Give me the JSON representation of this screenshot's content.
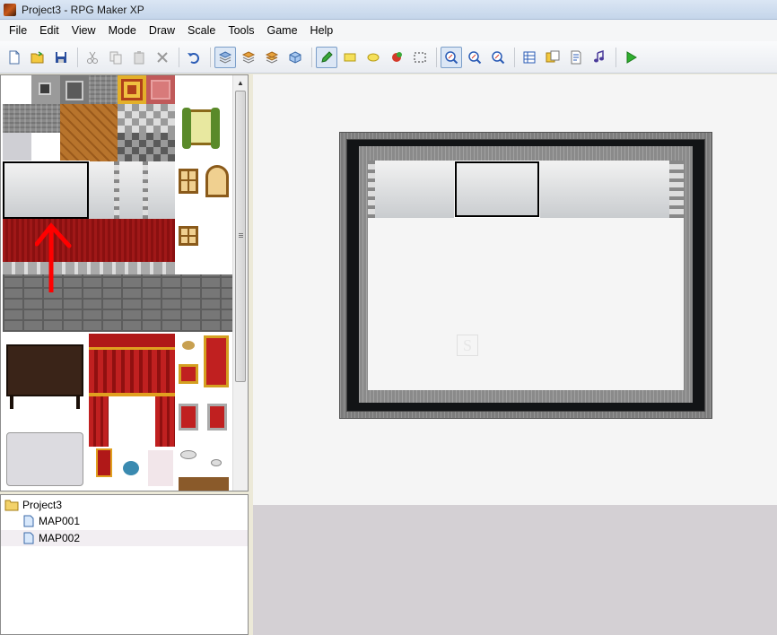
{
  "window": {
    "title": "Project3 - RPG Maker XP"
  },
  "menu": [
    "File",
    "Edit",
    "View",
    "Mode",
    "Draw",
    "Scale",
    "Tools",
    "Game",
    "Help"
  ],
  "toolbar": {
    "buttons": [
      {
        "icon": "new-icon"
      },
      {
        "icon": "open-icon"
      },
      {
        "icon": "save-icon"
      },
      {
        "icon": "cut-icon"
      },
      {
        "icon": "copy-icon"
      },
      {
        "icon": "paste-icon"
      },
      {
        "icon": "delete-icon"
      },
      {
        "icon": "undo-icon"
      },
      {
        "icon": "layer1-icon",
        "active": true
      },
      {
        "icon": "layer2-icon"
      },
      {
        "icon": "layer3-icon"
      },
      {
        "icon": "event-layer-icon"
      },
      {
        "icon": "pencil-icon",
        "active": true
      },
      {
        "icon": "rectangle-icon"
      },
      {
        "icon": "ellipse-icon"
      },
      {
        "icon": "fill-icon"
      },
      {
        "icon": "select-icon"
      },
      {
        "icon": "zoom-1-1-icon",
        "active": true
      },
      {
        "icon": "zoom-1-2-icon"
      },
      {
        "icon": "zoom-1-4-icon"
      },
      {
        "icon": "database-icon"
      },
      {
        "icon": "materials-icon"
      },
      {
        "icon": "script-editor-icon"
      },
      {
        "icon": "sound-test-icon"
      },
      {
        "icon": "playtest-icon"
      }
    ]
  },
  "map_tree": {
    "project": "Project3",
    "maps": [
      {
        "name": "MAP001",
        "selected": false
      },
      {
        "name": "MAP002",
        "selected": true
      }
    ]
  },
  "map": {
    "player_start_marker": "S"
  },
  "colors": {
    "annotation_arrow": "#ff0000"
  }
}
